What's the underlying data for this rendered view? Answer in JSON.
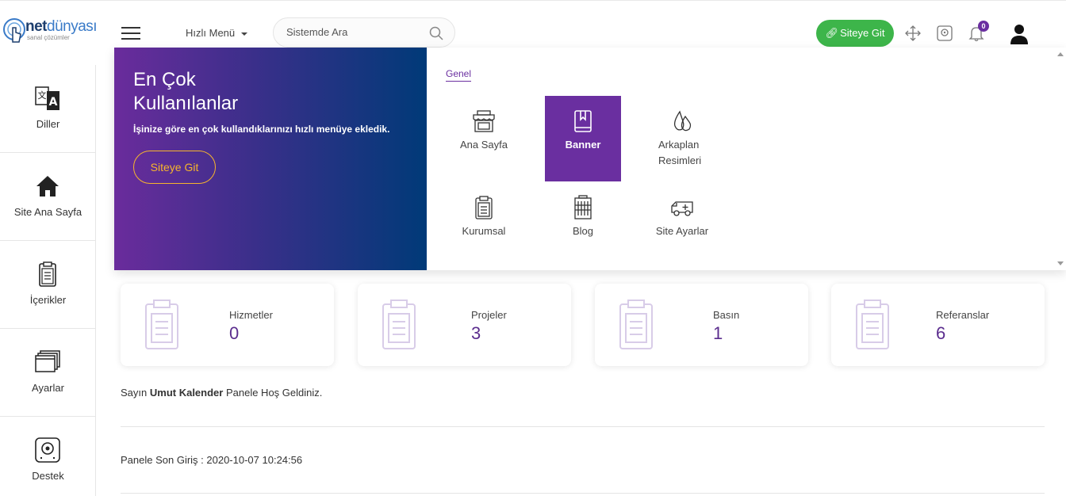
{
  "header": {
    "logo_brand_bold": "net",
    "logo_brand_light": "dünyası",
    "logo_tagline": "sanal çözümler",
    "quick_menu_label": "Hızlı Menü",
    "search_placeholder": "Sistemde Ara",
    "site_button_label": "Siteye Git",
    "notification_count": "0",
    "accent_color": "#6a2fa0",
    "button_color": "#3db54a"
  },
  "sidebar": {
    "items": [
      {
        "label": "Diller",
        "icon": "translate-icon"
      },
      {
        "label": "Site Ana Sayfa",
        "icon": "home-icon"
      },
      {
        "label": "İçerikler",
        "icon": "clipboard-icon"
      },
      {
        "label": "Ayarlar",
        "icon": "windows-icon"
      },
      {
        "label": "Destek",
        "icon": "support-icon"
      }
    ]
  },
  "mega_menu": {
    "promo": {
      "title_line1": "En Çok",
      "title_line2": "Kullanılanlar",
      "description": "İşinize göre en çok kullandıklarınızı hızlı menüye ekledik.",
      "button_label": "Siteye Git"
    },
    "tab_label": "Genel",
    "tiles": [
      {
        "label": "Ana Sayfa",
        "icon": "store-icon",
        "active": false
      },
      {
        "label": "Banner",
        "icon": "book-icon",
        "active": true
      },
      {
        "label": "Arkaplan Resimleri",
        "icon": "drops-icon",
        "active": false
      },
      {
        "label": "Kurumsal",
        "icon": "clipboard-icon",
        "active": false
      },
      {
        "label": "Blog",
        "icon": "building-icon",
        "active": false
      },
      {
        "label": "Site Ayarlar",
        "icon": "ambulance-icon",
        "active": false
      }
    ]
  },
  "stats": [
    {
      "label": "Hizmetler",
      "value": "0"
    },
    {
      "label": "Projeler",
      "value": "3"
    },
    {
      "label": "Basın",
      "value": "1"
    },
    {
      "label": "Referanslar",
      "value": "6"
    }
  ],
  "welcome": {
    "prefix": "Sayın",
    "user_name": "Umut Kalender",
    "suffix": "Panele Hoş Geldiniz."
  },
  "last_login": "Panele Son Giriş : 2020-10-07 10:24:56"
}
